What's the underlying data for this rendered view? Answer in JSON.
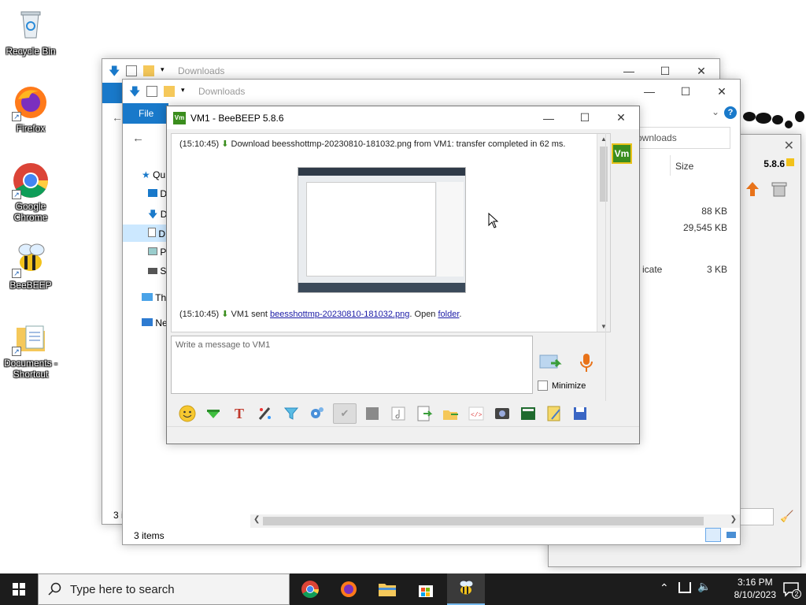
{
  "desktop": {
    "icons": [
      {
        "label": "Recycle Bin"
      },
      {
        "label": "Firefox"
      },
      {
        "label": "Google Chrome"
      },
      {
        "label": "BeeBEEP"
      },
      {
        "label": "Documents - Shortcut"
      }
    ]
  },
  "explorer_back": {
    "title": "Downloads",
    "status": "3 i"
  },
  "explorer_front": {
    "title": "Downloads",
    "ribbon_file": "File",
    "sidebar": [
      "Qu",
      "D",
      "D",
      "D",
      "P",
      "S",
      "Th",
      "Ne"
    ],
    "address_right": "ownloads",
    "column_size": "Size",
    "sizes": [
      "88 KB",
      "29,545 KB",
      "3 KB"
    ],
    "partial_type": "icate",
    "status": "3 items"
  },
  "beebeep_back": {
    "version": "5.8.6"
  },
  "beebeep": {
    "title": "VM1 - BeeBEEP 5.8.6",
    "badge": "Vm",
    "chat": {
      "line1_time": "(15:10:45)",
      "line1_text": "Download beesshottmp-20230810-181032.png from VM1: transfer completed in 62 ms.",
      "line2_time": "(15:10:45)",
      "line2_prefix": "VM1 sent",
      "line2_link": "beesshottmp-20230810-181032.png",
      "line2_mid": ". Open",
      "line2_folder": "folder",
      "line2_end": "."
    },
    "message_placeholder": "Write a message to VM1",
    "minimize_label": "Minimize"
  },
  "taskbar": {
    "search_placeholder": "Type here to search",
    "time": "3:16 PM",
    "date": "8/10/2023",
    "notifications": "2"
  },
  "colors": {
    "accent_blue": "#1979ca",
    "badge_green": "#3a8d1d",
    "taskbar": "#1c1c1c"
  }
}
